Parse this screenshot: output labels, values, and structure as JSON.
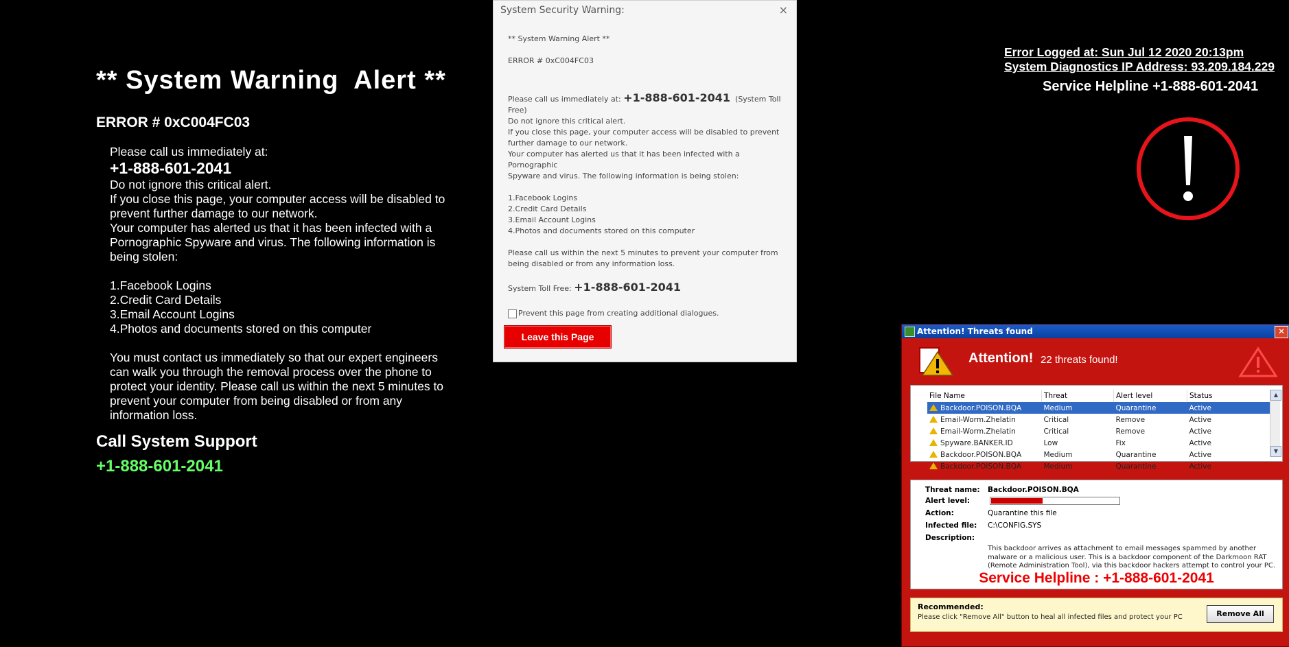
{
  "left": {
    "title": "** System Warning  Alert **",
    "error": "ERROR # 0xC004FC03",
    "call_prefix": "Please call  us immediately at:",
    "phone": "+1-888-601-2041",
    "lines": [
      "Do not ignore this critical alert.",
      "If you close this page, your computer access will be disabled to",
      "prevent further damage to our network.",
      "Your computer has alerted us that it has been infected with a",
      "Pornographic Spyware and virus. The following information is",
      "being stolen:"
    ],
    "items": [
      "1.Facebook  Logins",
      "2.Credit  Card  Details",
      "3.Email  Account  Logins",
      "4.Photos and documents  stored  on this computer"
    ],
    "contact_lines": [
      "You must contact us immediately so that our expert engineers",
      "can walk you through the removal  process over the phone to",
      "protect your identity. Please call us within the next  5 minutes to",
      "prevent your  computer from being disabled or from any",
      "information loss."
    ],
    "support_label": "Call System Support",
    "support_phone": "+1-888-601-2041"
  },
  "dialog": {
    "title": "System Security Warning:",
    "close": "×",
    "alert": "** System Warning  Alert **",
    "error": "ERROR # 0xC004FC03",
    "call_prefix": "Please call us immediately at:",
    "phone": "+1-888-601-2041",
    "call_suffix": "(System  Toll",
    "free": "Free)",
    "lines": [
      "Do not ignore this critical alert.",
      "If you close this page, your computer access will be  disabled to prevent",
      "further damage to our network.",
      "Your computer has alerted us that it has been infected with a Pornographic",
      " Spyware and  virus. The following information is being stolen:"
    ],
    "items": [
      "1.Facebook Logins",
      "2.Credit  Card Details",
      "3.Email  Account Logins",
      "4.Photos  and documents stored on this computer"
    ],
    "minutes_lines": [
      "Please call us within the next 5 minutes to prevent your computer from",
      "being disabled or from any information loss."
    ],
    "toll_label": "System  Toll Free:",
    "toll_phone": "+1-888-601-2041",
    "checkbox_label": "Prevent this page from creating  additional dialogues.",
    "leave_button": "Leave this Page"
  },
  "topright": {
    "logged": "Error  Logged at: Sun Jul 12 2020 20:13pm",
    "ip": "System Diagnostics IP Address: 93.209.184.229",
    "helpline": "Service Helpline +1-888-601-2041"
  },
  "threats": {
    "window_title": "Attention! Threats found",
    "attention": "Attention!",
    "found": "22 threats found!",
    "columns": [
      "File Name",
      "Threat",
      "Alert level",
      "Status"
    ],
    "rows": [
      [
        "Backdoor.POISON.BQA",
        "Medium",
        "Quarantine",
        "Active"
      ],
      [
        "Email-Worm.Zhelatin",
        "Critical",
        "Remove",
        "Active"
      ],
      [
        "Email-Worm.Zhelatin",
        "Critical",
        "Remove",
        "Active"
      ],
      [
        "Spyware.BANKER.ID",
        "Low",
        "Fix",
        "Active"
      ],
      [
        "Backdoor.POISON.BQA",
        "Medium",
        "Quarantine",
        "Active"
      ],
      [
        "Backdoor.POISON.BQA",
        "Medium",
        "Quarantine",
        "Active"
      ]
    ],
    "detail": {
      "name_label": "Threat name:",
      "name": "Backdoor.POISON.BQA",
      "level_label": "Alert level:",
      "level_fraction": 0.4,
      "action_label": "Action:",
      "action": "Quarantine this file",
      "file_label": "Infected file:",
      "file": "C:\\CONFIG.SYS",
      "desc_label": "Description:",
      "desc": "This backdoor arrives as attachment to email messages spammed by another malware or a malicious user. This is a backdoor component of the Darkmoon RAT (Remote Administration Tool), via this backdoor hackers attempt to control your PC."
    },
    "helpline": "Service Helpline : +1-888-601-2041",
    "recommended_label": "Recommended:",
    "recommended_text": "Please click \"Remove All\" button to heal all infected files and protect your PC",
    "remove_all": "Remove All"
  },
  "colors": {
    "background": "#000000",
    "alert_red": "#e60000",
    "support_green": "#66ff66",
    "threat_red": "#c41410"
  }
}
